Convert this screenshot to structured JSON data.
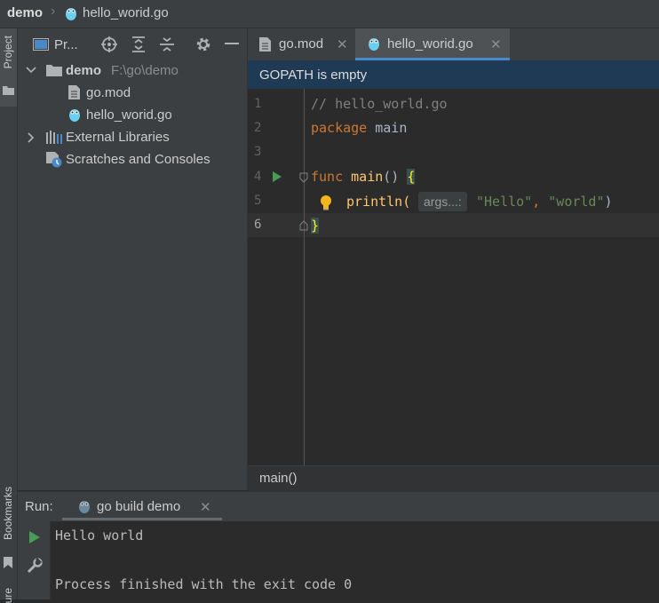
{
  "navbar": {
    "project": "demo",
    "file": "hello_worid.go"
  },
  "stripe": {
    "project_label": "Project",
    "bookmarks_label": "Bookmarks",
    "structure_label": "ure"
  },
  "project_panel": {
    "title": "Pr...",
    "root_name": "demo",
    "root_path": "F:\\go\\demo",
    "files": [
      "go.mod",
      "hello_worid.go"
    ],
    "external_libraries": "External Libraries",
    "scratches": "Scratches and Consoles"
  },
  "tabs": [
    {
      "label": "go.mod"
    },
    {
      "label": "hello_worid.go"
    }
  ],
  "notice": "GOPATH is empty",
  "editor": {
    "line_numbers": [
      "1",
      "2",
      "3",
      "4",
      "5",
      "6"
    ],
    "line1": "// hello_world.go",
    "line2_kw": "package",
    "line2_id": "main",
    "line4_kw": "func",
    "line4_fn": "main",
    "line4_rest": "() ",
    "line4_brace": "{",
    "line5_fn": "println(",
    "line5_hint": "args...:",
    "line5_str1": "\"Hello\"",
    "line5_comma": ", ",
    "line5_str2": "\"world\"",
    "line5_close": ")",
    "line6_brace": "}"
  },
  "breadcrumb": "main()",
  "run": {
    "label": "Run:",
    "tab": "go build demo",
    "output": [
      "Hello world",
      "",
      "Process finished with the exit code 0"
    ]
  },
  "colors": {
    "accent": "#4a88c7",
    "run_green": "#499c54",
    "gopher_blue": "#6ad0f0"
  }
}
